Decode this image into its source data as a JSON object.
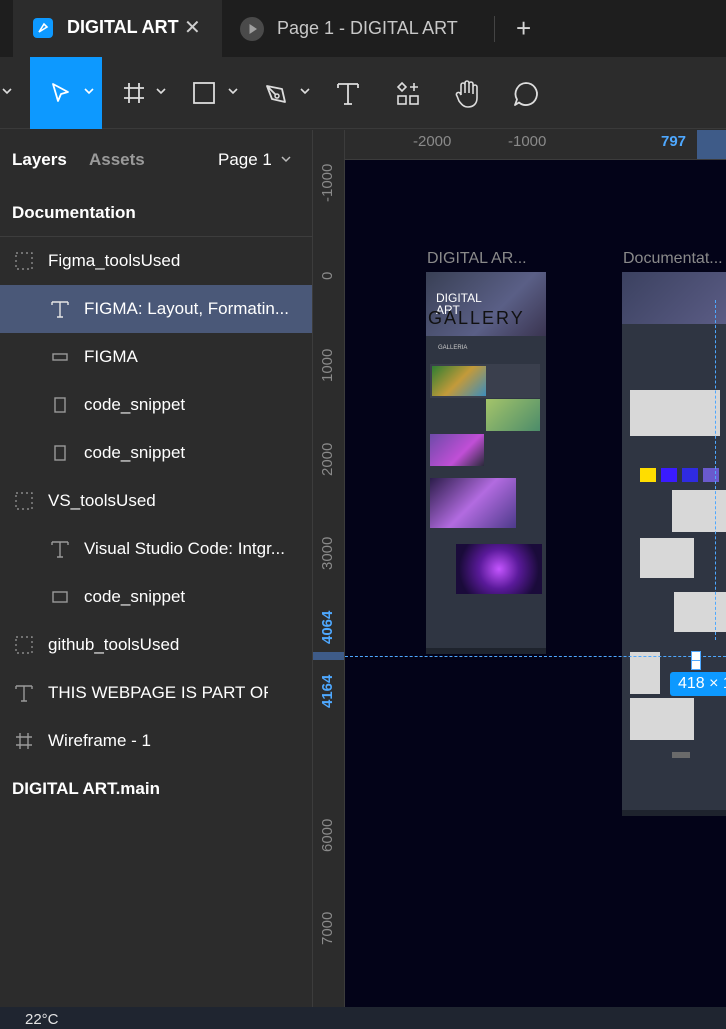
{
  "tabs": {
    "active": {
      "title": "DIGITAL ART",
      "close_glyph": "✕"
    },
    "second": {
      "title": "Page 1 - DIGITAL ART"
    },
    "new_tab_glyph": "+"
  },
  "toolbar": {
    "tools": [
      {
        "name": "main-menu",
        "icon": "chevron-down-icon"
      },
      {
        "name": "move",
        "icon": "cursor-arrow-icon",
        "active": true
      },
      {
        "name": "frame",
        "icon": "frame-hash-icon"
      },
      {
        "name": "shape",
        "icon": "rectangle-icon"
      },
      {
        "name": "pen",
        "icon": "pen-icon"
      },
      {
        "name": "text",
        "icon": "text-t-icon"
      },
      {
        "name": "resources",
        "icon": "resources-icon"
      },
      {
        "name": "hand",
        "icon": "hand-icon"
      },
      {
        "name": "comment",
        "icon": "comment-bubble-icon"
      }
    ],
    "accent": "#0d99ff"
  },
  "panel": {
    "tab_layers": "Layers",
    "tab_assets": "Assets",
    "page_selector": "Page 1",
    "section_title": "Documentation",
    "layers": [
      {
        "label": "Figma_toolsUsed",
        "icon": "group-dotted-icon"
      },
      {
        "label": "FIGMA: Layout, Formatin...",
        "icon": "text-t-icon",
        "selected": true
      },
      {
        "label": "FIGMA",
        "icon": "rectangle-icon"
      },
      {
        "label": "code_snippet",
        "icon": "frame-icon"
      },
      {
        "label": "code_snippet",
        "icon": "frame-icon"
      },
      {
        "label": "VS_toolsUsed",
        "icon": "group-dotted-icon"
      },
      {
        "label": "Visual Studio Code: Intgr...",
        "icon": "text-t-icon"
      },
      {
        "label": "code_snippet",
        "icon": "rectangle-icon"
      },
      {
        "label": "github_toolsUsed",
        "icon": "group-dotted-icon"
      },
      {
        "label": "THIS WEBPAGE IS PART OF S...",
        "icon": "text-t-icon"
      },
      {
        "label": "Wireframe - 1",
        "icon": "frame-hash-icon"
      }
    ],
    "page_footer_item": "DIGITAL ART.main",
    "selection_color": "#4a5878"
  },
  "rulers": {
    "horizontal": [
      "-2000",
      "-1000",
      "797"
    ],
    "vertical": [
      "-1000",
      "0",
      "1000",
      "2000",
      "3000",
      "4064",
      "4164",
      "6000",
      "7000"
    ],
    "highlight_color": "#4ea8ff"
  },
  "canvas": {
    "frames": [
      {
        "label": "DIGITAL AR...",
        "heading": "DIGITAL ART",
        "banner": "GALLERY",
        "section": "GALLERIA"
      },
      {
        "label": "Documentat..."
      }
    ],
    "size_badge": "418 × 1",
    "palette": [
      "#ffdd00",
      "#3a1bff",
      "#2f2be0",
      "#6a5acd",
      "#584fa0"
    ],
    "background": "#030318"
  },
  "taskbar": {
    "temperature": "22°C"
  }
}
